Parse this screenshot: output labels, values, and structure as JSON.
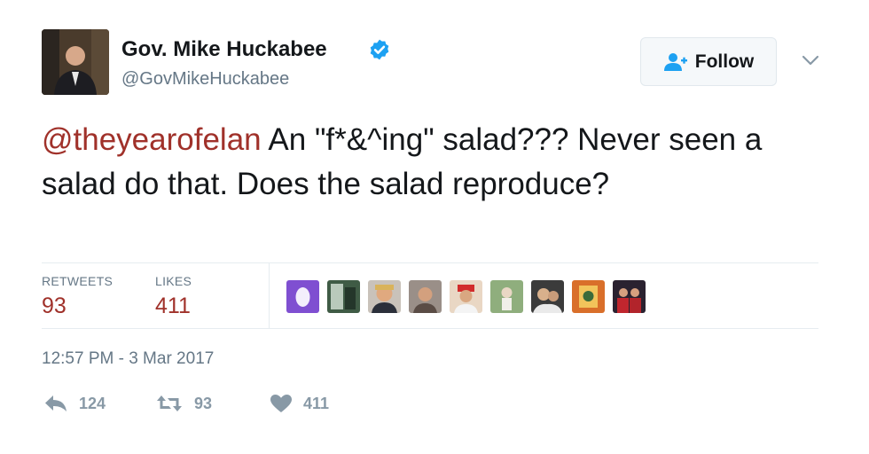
{
  "profile": {
    "name": "Gov. Mike Huckabee",
    "handle": "@GovMikeHuckabee",
    "verified_icon": "verified-badge-icon"
  },
  "follow_label": "Follow",
  "tweet": {
    "mention": "@theyearofelan",
    "text": " An \"f*&^ing\" salad???  Never seen a salad do that. Does the salad reproduce?"
  },
  "stats": {
    "retweets_label": "RETWEETS",
    "retweets_value": "93",
    "likes_label": "LIKES",
    "likes_value": "411"
  },
  "timestamp": "12:57 PM - 3 Mar 2017",
  "actions": {
    "reply_count": "124",
    "retweet_count": "93",
    "like_count": "411"
  },
  "colors": {
    "accent": "#a0312a",
    "muted": "#657786",
    "verified": "#1da1f2"
  }
}
